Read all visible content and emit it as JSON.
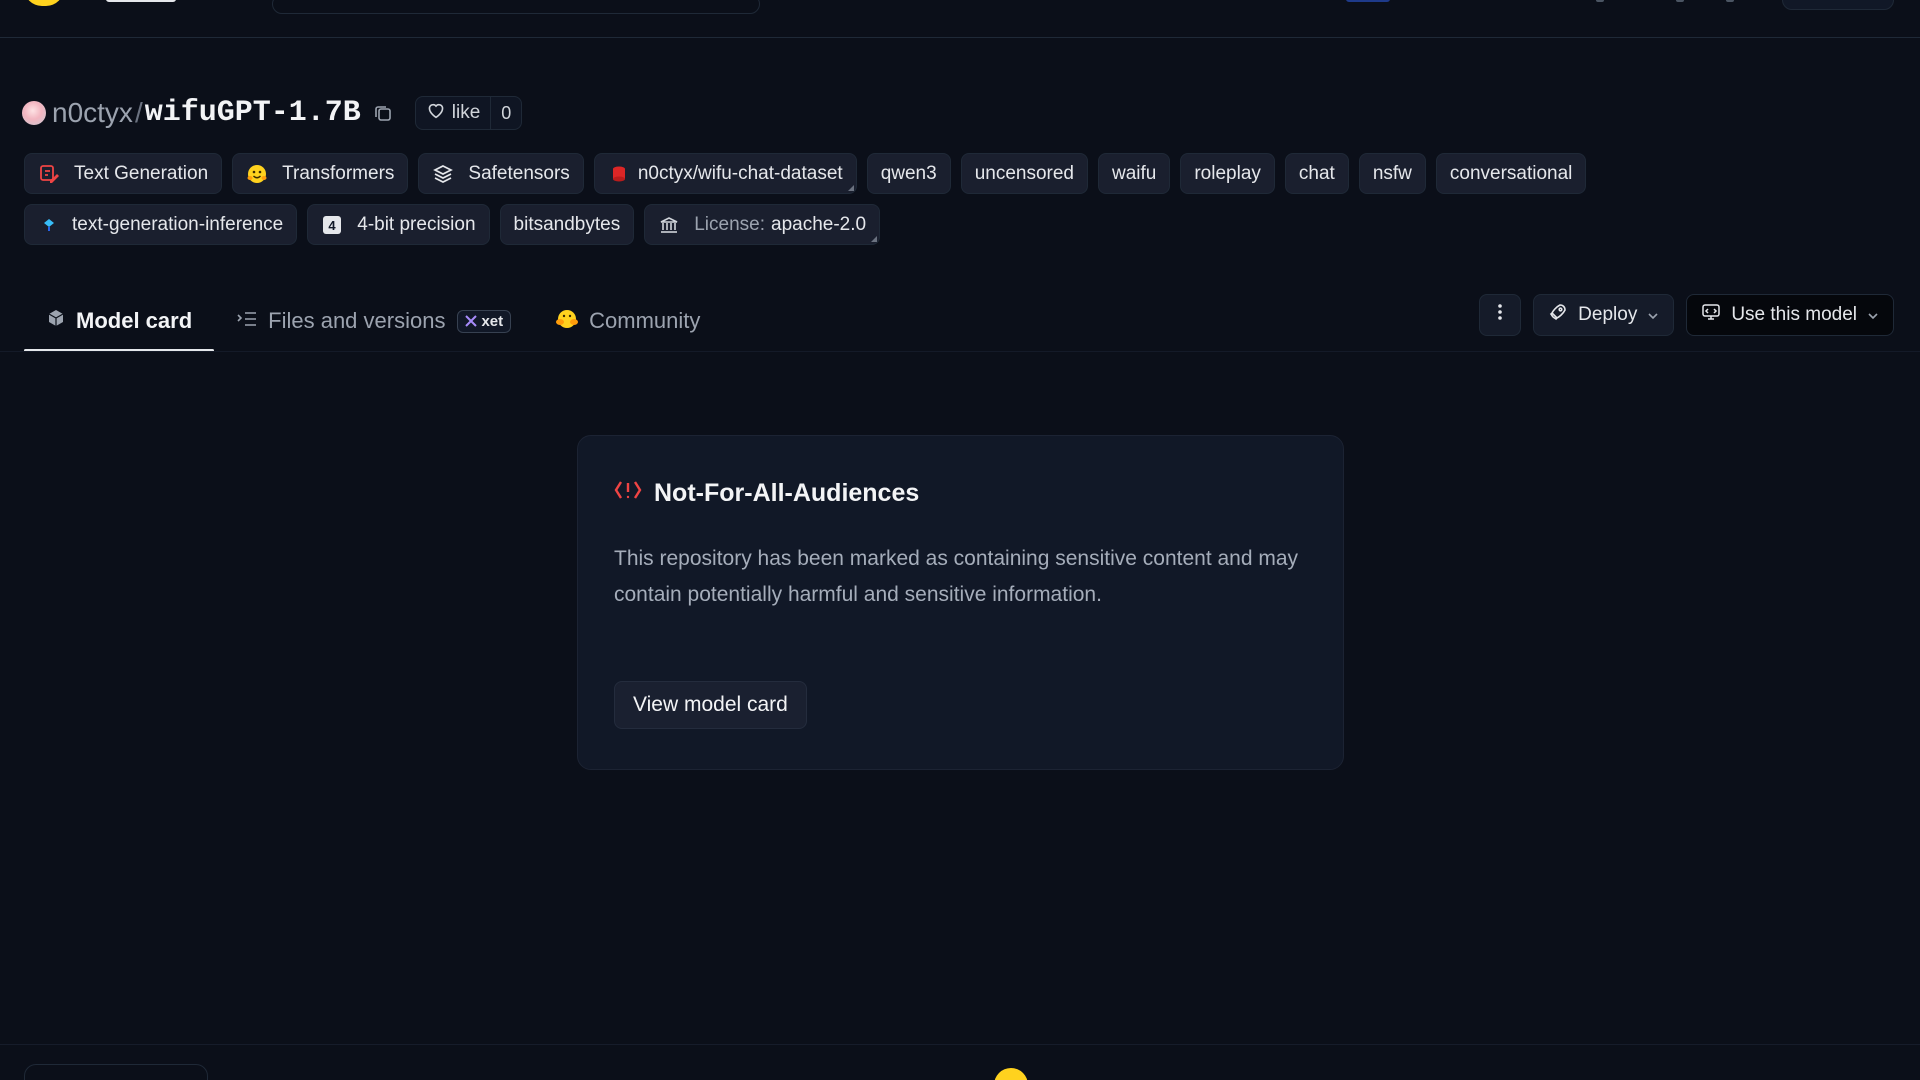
{
  "header": {
    "owner": "n0ctyx",
    "separator": "/",
    "repo": "wifuGPT-1.7B",
    "like_label": "like",
    "like_count": "0"
  },
  "tags_row1": [
    {
      "label": "Text Generation",
      "icon": "text-generation-icon"
    },
    {
      "label": "Transformers",
      "icon": "hugging-face-icon"
    },
    {
      "label": "Safetensors",
      "icon": "layers-icon"
    },
    {
      "label": "n0ctyx/wifu-chat-dataset",
      "icon": "dataset-icon"
    },
    {
      "label": "qwen3"
    },
    {
      "label": "uncensored"
    },
    {
      "label": "waifu"
    },
    {
      "label": "roleplay"
    },
    {
      "label": "chat"
    },
    {
      "label": "nsfw"
    },
    {
      "label": "conversational"
    }
  ],
  "tags_row2": [
    {
      "label": "text-generation-inference",
      "icon": "inference-icon"
    },
    {
      "label": "4-bit precision",
      "icon": "precision-icon"
    },
    {
      "label": "bitsandbytes"
    },
    {
      "license_prefix": "License:",
      "label": "apache-2.0",
      "icon": "license-icon"
    }
  ],
  "tabs": [
    {
      "label": "Model card",
      "icon": "cube-icon",
      "active": true
    },
    {
      "label": "Files and versions",
      "icon": "files-icon",
      "badge": "xet"
    },
    {
      "label": "Community",
      "icon": "community-icon"
    }
  ],
  "actions": {
    "deploy": "Deploy",
    "use_model": "Use this model"
  },
  "notice": {
    "title": "Not-For-All-Audiences",
    "body": "This repository has been marked as containing sensitive content and may contain potentially harmful and sensitive information.",
    "button": "View model card"
  },
  "colors": {
    "background": "#0b0f19",
    "card": "#111827",
    "warning": "#ef4444",
    "brand_yellow": "#ffd21e"
  }
}
